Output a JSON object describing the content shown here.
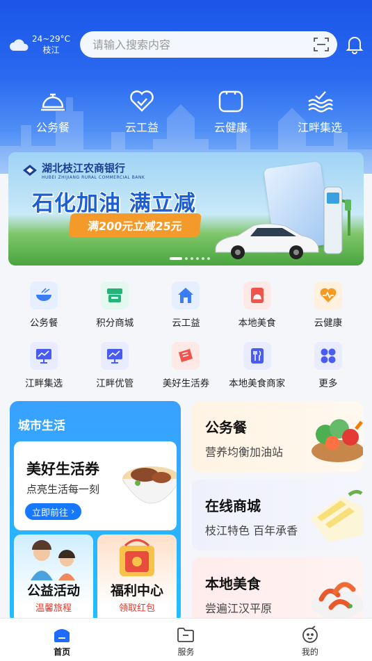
{
  "weather": {
    "temp": "24~29°C",
    "city": "枝江",
    "icon": "cloud-icon"
  },
  "search": {
    "placeholder": "请输入搜索内容"
  },
  "topnav": [
    {
      "label": "公务餐",
      "icon": "service-bell-icon"
    },
    {
      "label": "云工益",
      "icon": "heart-hands-icon"
    },
    {
      "label": "云健康",
      "icon": "health-box-icon"
    },
    {
      "label": "江畔集选",
      "icon": "waves-bird-icon"
    }
  ],
  "banner": {
    "bank_name": "湖北枝江农商银行",
    "bank_name_en": "HUBEI ZHIJIANG RURAL COMMERCIAL BANK",
    "headline": "石化加油 满立减",
    "ribbon": "满200元立减25元",
    "slide_count": 6,
    "active_slide": 0
  },
  "grid": {
    "row1": [
      {
        "label": "公务餐",
        "icon": "bowl-icon",
        "bg": "#e6efff",
        "color": "#3b7cf5"
      },
      {
        "label": "积分商城",
        "icon": "shop-icon",
        "bg": "#e3f8ef",
        "color": "#26b37a"
      },
      {
        "label": "云工益",
        "icon": "house-icon",
        "bg": "#e6efff",
        "color": "#3b7cf5"
      },
      {
        "label": "本地美食",
        "icon": "food-box-icon",
        "bg": "#ffe9e7",
        "color": "#f0534a"
      },
      {
        "label": "云健康",
        "icon": "heart-pulse-icon",
        "bg": "#fff1dd",
        "color": "#f59a23"
      }
    ],
    "row2": [
      {
        "label": "江畔集选",
        "icon": "chart-screen-icon",
        "bg": "#e9ecff",
        "color": "#4a5cf0"
      },
      {
        "label": "江畔优管",
        "icon": "chart-screen-icon",
        "bg": "#e9ecff",
        "color": "#4a5cf0"
      },
      {
        "label": "美好生活券",
        "icon": "ticket-icon",
        "bg": "#ffe9e7",
        "color": "#f0534a"
      },
      {
        "label": "本地美食商家",
        "icon": "fork-knife-icon",
        "bg": "#e9ecff",
        "color": "#4a5cf0"
      },
      {
        "label": "更多",
        "icon": "more-icon",
        "bg": "#e9ecff",
        "color": "#4a5cf0"
      }
    ]
  },
  "city": {
    "title": "城市生活",
    "main": {
      "title": "美好生活券",
      "subtitle": "点亮生活每一刻",
      "button": "立即前往"
    },
    "sub_a": {
      "title": "公益活动",
      "subtitle": "温馨旅程"
    },
    "sub_b": {
      "title": "福利中心",
      "subtitle": "领取红包"
    }
  },
  "right_cards": [
    {
      "title": "公务餐",
      "subtitle": "营养均衡加油站"
    },
    {
      "title": "在线商城",
      "subtitle": "枝江特色 百年承香"
    },
    {
      "title": "本地美食",
      "subtitle": "尝遍江汉平原"
    }
  ],
  "tabbar": [
    {
      "label": "首页",
      "icon": "home-icon",
      "active": true
    },
    {
      "label": "服务",
      "icon": "folder-icon",
      "active": false
    },
    {
      "label": "我的",
      "icon": "profile-face-icon",
      "active": false
    }
  ]
}
